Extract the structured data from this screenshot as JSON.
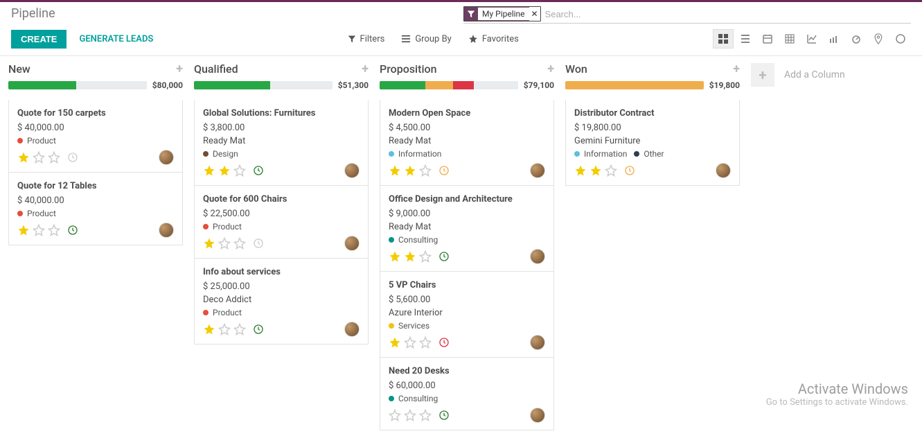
{
  "header": {
    "page_title": "Pipeline"
  },
  "search": {
    "facet_label": "My Pipeline",
    "placeholder": "Search..."
  },
  "buttons": {
    "create": "CREATE",
    "generate_leads": "GENERATE LEADS",
    "filters": "Filters",
    "group_by": "Group By",
    "favorites": "Favorites",
    "add_column": "Add a Column"
  },
  "palette": {
    "green": "#28a745",
    "orange": "#f0ad4e",
    "red": "#dc3545",
    "grey": "#e9ecef",
    "tag_red": "#e74c3c",
    "tag_brown": "#6f4e37",
    "tag_lblue": "#5bc0de",
    "tag_teal": "#009688",
    "tag_navy": "#2c3e50",
    "tag_yellow": "#f1c40f"
  },
  "columns": [
    {
      "title": "New",
      "total": "$80,000",
      "segments": [
        {
          "colorKey": "green",
          "pct": 49
        },
        {
          "colorKey": "grey",
          "pct": 51
        }
      ],
      "cards": [
        {
          "title": "Quote for 150 carpets",
          "amount": "$ 40,000.00",
          "tags": [
            {
              "label": "Product",
              "colorKey": "tag_red"
            }
          ],
          "stars": 1,
          "clock": "grey",
          "avatar": true
        },
        {
          "title": "Quote for 12 Tables",
          "amount": "$ 40,000.00",
          "tags": [
            {
              "label": "Product",
              "colorKey": "tag_red"
            }
          ],
          "stars": 1,
          "clock": "green",
          "avatar": true
        }
      ]
    },
    {
      "title": "Qualified",
      "total": "$51,300",
      "segments": [
        {
          "colorKey": "green",
          "pct": 55
        },
        {
          "colorKey": "grey",
          "pct": 45
        }
      ],
      "cards": [
        {
          "title": "Global Solutions: Furnitures",
          "amount": "$ 3,800.00",
          "subtitle": "Ready Mat",
          "tags": [
            {
              "label": "Design",
              "colorKey": "tag_brown"
            }
          ],
          "stars": 2,
          "clock": "green",
          "avatar": true
        },
        {
          "title": "Quote for 600 Chairs",
          "amount": "$ 22,500.00",
          "tags": [
            {
              "label": "Product",
              "colorKey": "tag_red"
            }
          ],
          "stars": 1,
          "clock": "grey",
          "avatar": true
        },
        {
          "title": "Info about services",
          "amount": "$ 25,000.00",
          "subtitle": "Deco Addict",
          "tags": [
            {
              "label": "Product",
              "colorKey": "tag_red"
            }
          ],
          "stars": 1,
          "clock": "green",
          "avatar": true
        }
      ]
    },
    {
      "title": "Proposition",
      "total": "$79,100",
      "segments": [
        {
          "colorKey": "green",
          "pct": 33
        },
        {
          "colorKey": "orange",
          "pct": 20
        },
        {
          "colorKey": "red",
          "pct": 15
        },
        {
          "colorKey": "grey",
          "pct": 32
        }
      ],
      "cards": [
        {
          "title": "Modern Open Space",
          "amount": "$ 4,500.00",
          "subtitle": "Ready Mat",
          "tags": [
            {
              "label": "Information",
              "colorKey": "tag_lblue"
            }
          ],
          "stars": 2,
          "clock": "orange",
          "avatar": true
        },
        {
          "title": "Office Design and Architecture",
          "amount": "$ 9,000.00",
          "subtitle": "Ready Mat",
          "tags": [
            {
              "label": "Consulting",
              "colorKey": "tag_teal"
            }
          ],
          "stars": 2,
          "clock": "green",
          "avatar": true
        },
        {
          "title": "5 VP Chairs",
          "amount": "$ 5,600.00",
          "subtitle": "Azure Interior",
          "tags": [
            {
              "label": "Services",
              "colorKey": "tag_yellow"
            }
          ],
          "stars": 1,
          "clock": "red",
          "avatar": true
        },
        {
          "title": "Need 20 Desks",
          "amount": "$ 60,000.00",
          "tags": [
            {
              "label": "Consulting",
              "colorKey": "tag_teal"
            }
          ],
          "stars": 0,
          "clock": "green",
          "avatar": true
        }
      ]
    },
    {
      "title": "Won",
      "total": "$19,800",
      "segments": [
        {
          "colorKey": "orange",
          "pct": 100
        }
      ],
      "cards": [
        {
          "title": "Distributor Contract",
          "amount": "$ 19,800.00",
          "subtitle": "Gemini Furniture",
          "tags": [
            {
              "label": "Information",
              "colorKey": "tag_lblue"
            },
            {
              "label": "Other",
              "colorKey": "tag_navy"
            }
          ],
          "stars": 2,
          "clock": "orange",
          "avatar": true
        }
      ]
    }
  ],
  "watermark": {
    "l1": "Activate Windows",
    "l2": "Go to Settings to activate Windows."
  }
}
